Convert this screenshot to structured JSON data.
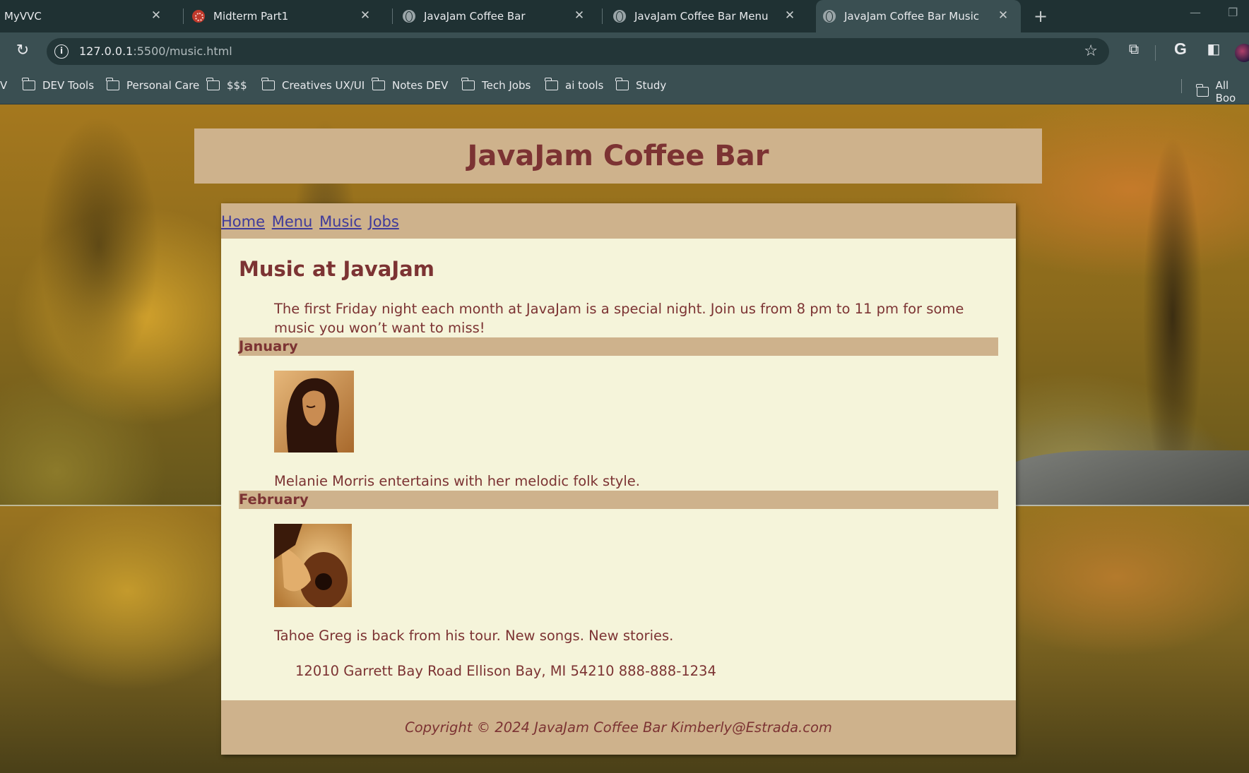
{
  "browser": {
    "tabs": [
      {
        "label": "MyVVC",
        "icon": "none",
        "active": false
      },
      {
        "label": "Midterm Part1",
        "icon": "canvas-logo-icon",
        "active": false
      },
      {
        "label": "JavaJam Coffee Bar",
        "icon": "globe-icon",
        "active": false
      },
      {
        "label": "JavaJam Coffee Bar Menu",
        "icon": "globe-icon",
        "active": false
      },
      {
        "label": "JavaJam Coffee Bar Music",
        "icon": "globe-icon",
        "active": true
      }
    ],
    "url_host": "127.0.0.1",
    "url_rest": ":5500/music.html",
    "bookmarks_cut": "V",
    "bookmarks": [
      "DEV Tools",
      "Personal Care",
      "$$$",
      "Creatives UX/UI",
      "Notes DEV",
      "Tech Jobs",
      "ai tools",
      "Study"
    ],
    "all_bookmarks": "All Boo"
  },
  "site": {
    "title": "JavaJam Coffee Bar",
    "nav": [
      "Home",
      "Menu",
      "Music",
      "Jobs"
    ],
    "heading": "Music at JavaJam",
    "intro": "The first Friday night each month at JavaJam is a special night. Join us from 8 pm to 11 pm for some music you won’t want to miss!",
    "events": [
      {
        "month": "January",
        "image": "melanie-morris-photo",
        "text": "Melanie Morris entertains with her melodic folk style."
      },
      {
        "month": "February",
        "image": "guitar-photo",
        "text": "Tahoe Greg is back from his tour. New songs. New stories."
      }
    ],
    "address": "12010 Garrett Bay Road Ellison Bay, MI 54210 888-888-1234",
    "footer": "Copyright © 2024 JavaJam Coffee Bar Kimberly@Estrada.com"
  },
  "colors": {
    "tan": "#ceb28c",
    "maroon": "#7c3333",
    "cream": "#f5f4da",
    "link": "#3e3a9b"
  }
}
